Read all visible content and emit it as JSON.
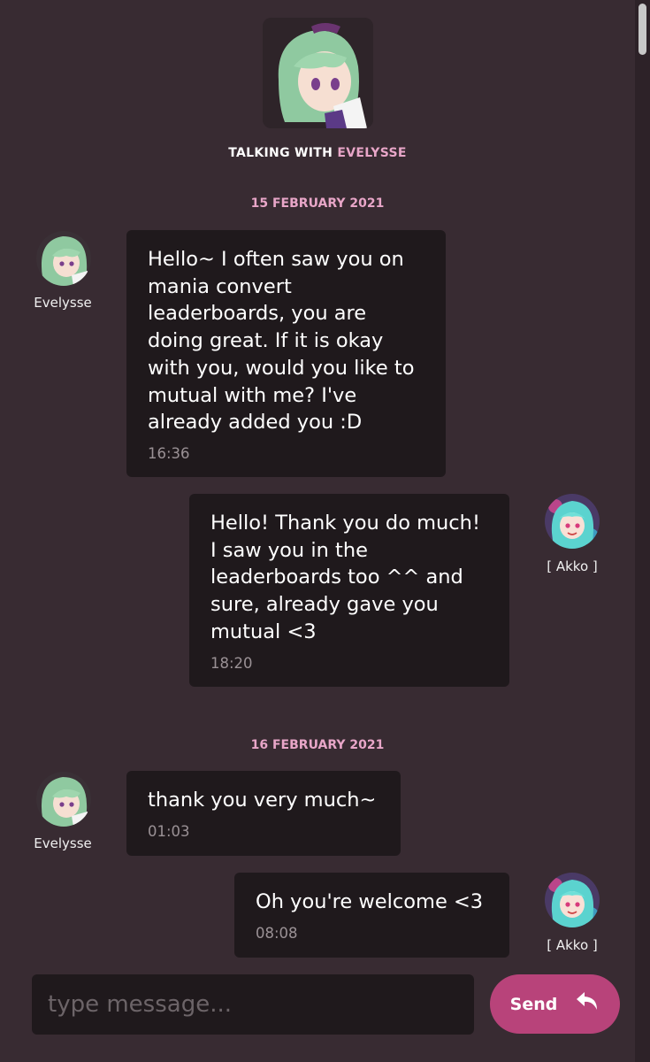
{
  "header": {
    "talking_prefix": "TALKING WITH",
    "talking_name": "EVELYSSE"
  },
  "dates": [
    "15 FEBRUARY 2021",
    "16 FEBRUARY 2021"
  ],
  "messages": [
    {
      "sender": "Evelysse",
      "text": "Hello~ I often saw you on\nmania convert\nleaderboards, you are\ndoing great. If it is okay\nwith you, would you like to\nmutual with me? I've\nalready added you :D",
      "time": "16:36"
    },
    {
      "sender": "[ Akko ]",
      "text": "Hello! Thank you do much!\nI saw you in the\nleaderboards too ^^ and\nsure, already gave you\nmutual <3",
      "time": "18:20"
    },
    {
      "sender": "Evelysse",
      "text": "thank you very much~",
      "time": "01:03"
    },
    {
      "sender": "[ Akko ]",
      "text": "Oh you're welcome <3",
      "time": "08:08"
    }
  ],
  "composer": {
    "placeholder": "type message...",
    "send_label": "Send"
  },
  "colors": {
    "background": "#382b32",
    "bubble": "#1f191c",
    "accent_pink": "#e8a6c8",
    "send_button": "#b8437a"
  },
  "icons": {
    "send": "reply-arrow-icon"
  }
}
